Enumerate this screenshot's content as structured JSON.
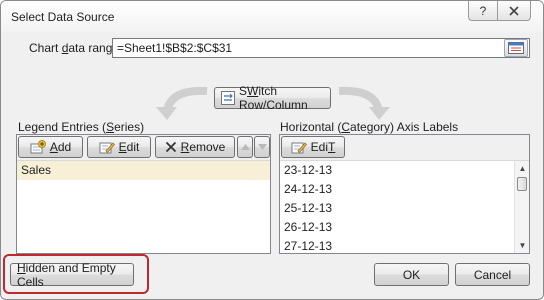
{
  "dialog": {
    "title": "Select Data Source",
    "help_icon": "question-mark",
    "close_icon": "close-x"
  },
  "chart_range": {
    "label_pre": "Chart ",
    "label_key": "d",
    "label_post": "ata range:",
    "value": "=Sheet1!$B$2:$C$31",
    "collapse_icon": "range-select-icon"
  },
  "switch_button": {
    "key": "W",
    "pre": "S",
    "post": "itch Row/Column",
    "icon": "switch-icon"
  },
  "legend": {
    "title_pre": "Legend Entries (",
    "title_key": "S",
    "title_post": "eries)",
    "add": {
      "key": "A",
      "post": "dd",
      "icon": "add-icon"
    },
    "edit": {
      "key": "E",
      "post": "dit",
      "icon": "edit-icon"
    },
    "remove": {
      "key": "R",
      "post": "emove",
      "icon": "remove-x-icon"
    },
    "up_icon": "arrow-up-icon",
    "down_icon": "arrow-down-icon",
    "items": [
      "Sales"
    ]
  },
  "axis": {
    "title_pre": "Horizontal (",
    "title_key": "C",
    "title_post": "ategory) Axis Labels",
    "edit": {
      "key": "T",
      "pre": "Edi",
      "post": "",
      "icon": "edit-icon"
    },
    "items": [
      "23-12-13",
      "24-12-13",
      "25-12-13",
      "26-12-13",
      "27-12-13"
    ]
  },
  "footer": {
    "hidden_key": "H",
    "hidden_post": "idden and Empty Cells",
    "ok": "OK",
    "cancel": "Cancel"
  },
  "colors": {
    "highlight": "#c0282d",
    "selection": "#f7f0d7"
  }
}
